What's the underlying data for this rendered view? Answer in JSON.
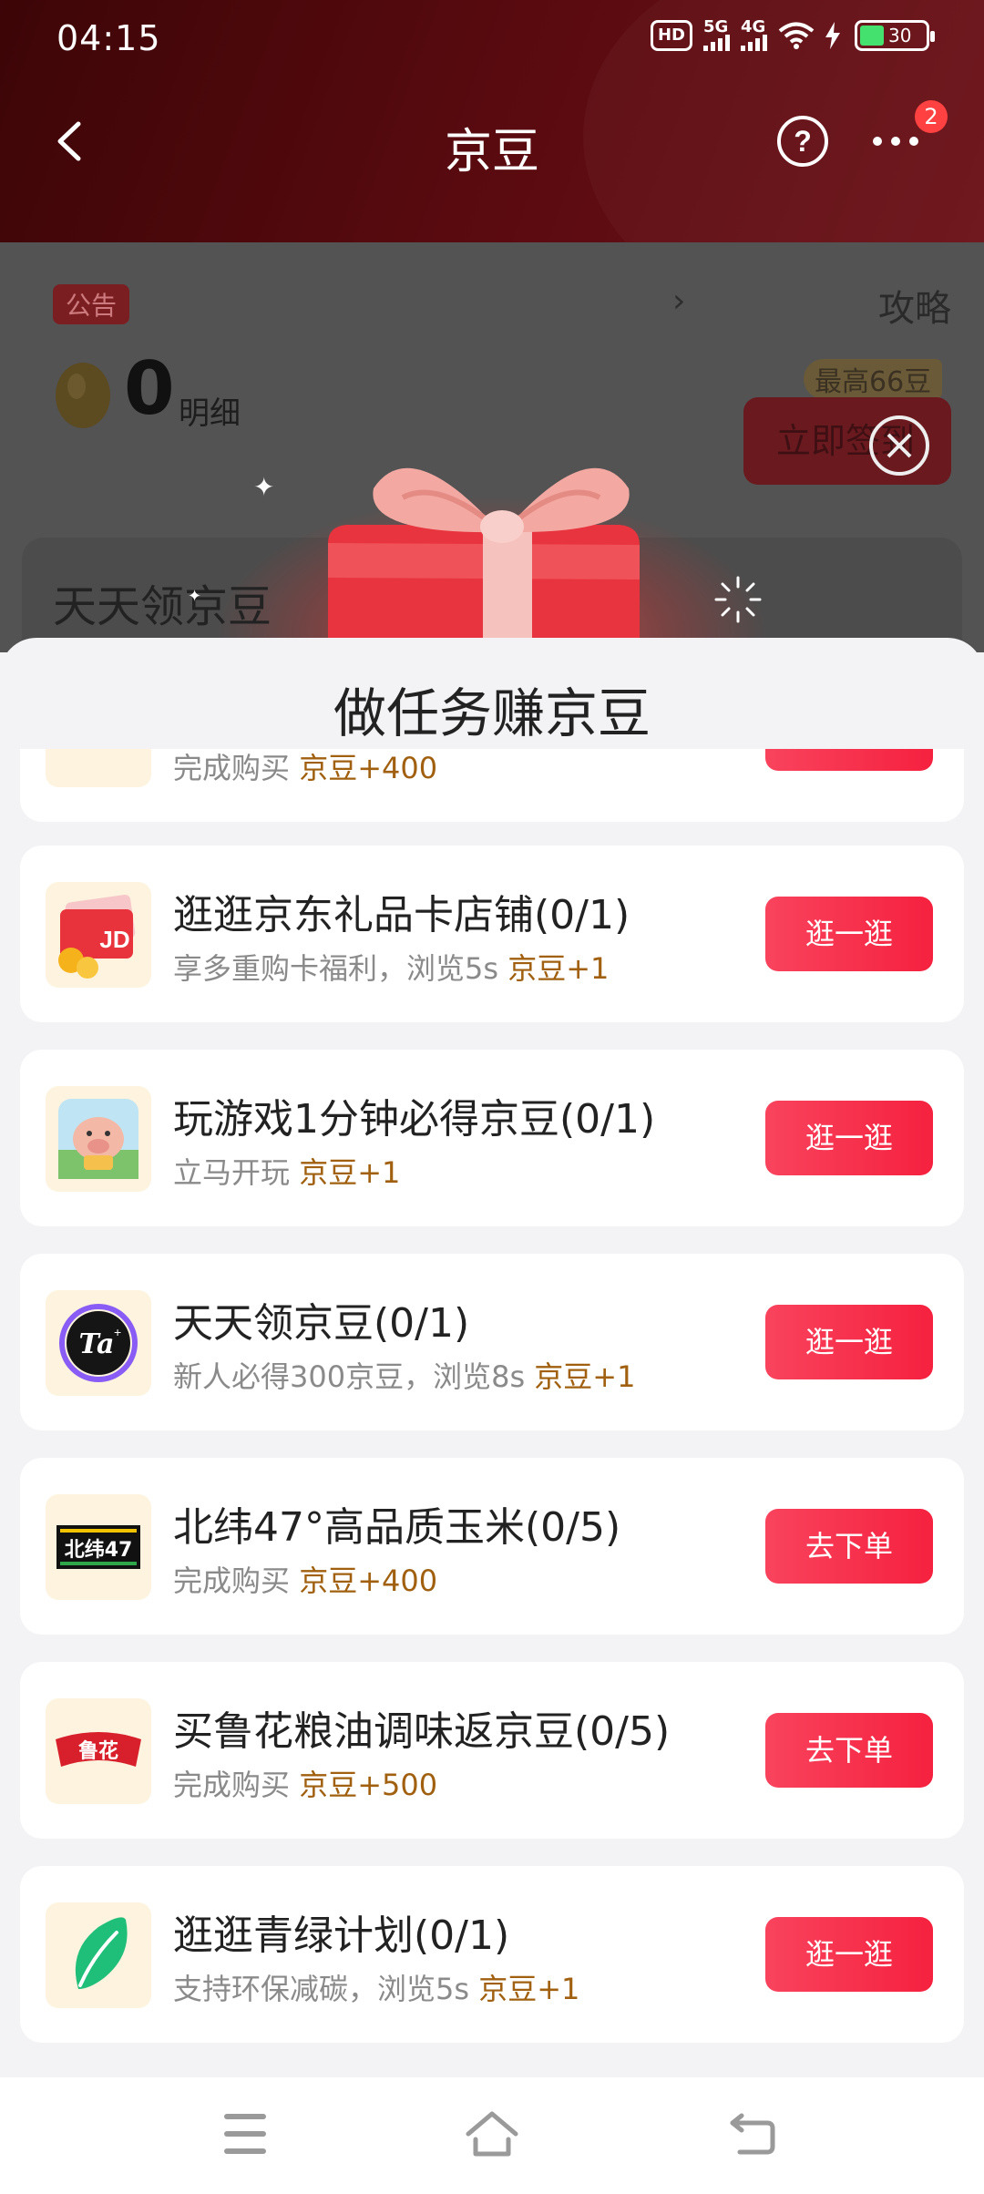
{
  "status_bar": {
    "time": "04:15",
    "hd_label": "HD",
    "net1": "5G",
    "net2": "4G",
    "battery": "30"
  },
  "nav": {
    "title": "京豆",
    "badge_count": "2"
  },
  "background": {
    "notice_tag": "公告",
    "notice_arrow": "›",
    "strategy": "攻略",
    "bean_count": "0",
    "detail_label": "明细",
    "max_tag": "最高66豆",
    "signin_label": "立即签到",
    "daily_title": "天天领京豆"
  },
  "sheet": {
    "title": "做任务赚京豆",
    "tasks": [
      {
        "icon": "partial-icon",
        "title": "",
        "desc": "完成购买",
        "reward": "京豆+400",
        "button": ""
      },
      {
        "icon": "gift-card-icon",
        "title": "逛逛京东礼品卡店铺(0/1)",
        "desc": "享多重购卡福利，浏览5s",
        "reward": "京豆+1",
        "button": "逛一逛"
      },
      {
        "icon": "pig-game-icon",
        "title": "玩游戏1分钟必得京豆(0/1)",
        "desc": "立马开玩",
        "reward": "京豆+1",
        "button": "逛一逛"
      },
      {
        "icon": "ta-logo-icon",
        "title": "天天领京豆(0/1)",
        "desc": "新人必得300京豆，浏览8s",
        "reward": "京豆+1",
        "button": "逛一逛"
      },
      {
        "icon": "beiwei47-logo-icon",
        "title": "北纬47°高品质玉米(0/5)",
        "desc": "完成购买",
        "reward": "京豆+400",
        "button": "去下单"
      },
      {
        "icon": "luhua-logo-icon",
        "title": "买鲁花粮油调味返京豆(0/5)",
        "desc": "完成购买",
        "reward": "京豆+500",
        "button": "去下单"
      },
      {
        "icon": "leaf-icon",
        "title": "逛逛青绿计划(0/1)",
        "desc": "支持环保减碳，浏览5s",
        "reward": "京豆+1",
        "button": "逛一逛"
      }
    ],
    "logo_texts": {
      "ta": "Ta",
      "beiwei": "北纬47",
      "luhua": "鲁花",
      "jd": "JD"
    }
  },
  "colors": {
    "header_dark_red": "#4a080b",
    "button_red": "#f5213f",
    "reward_brown": "#a0600f",
    "icon_bg": "#fdf3df"
  }
}
